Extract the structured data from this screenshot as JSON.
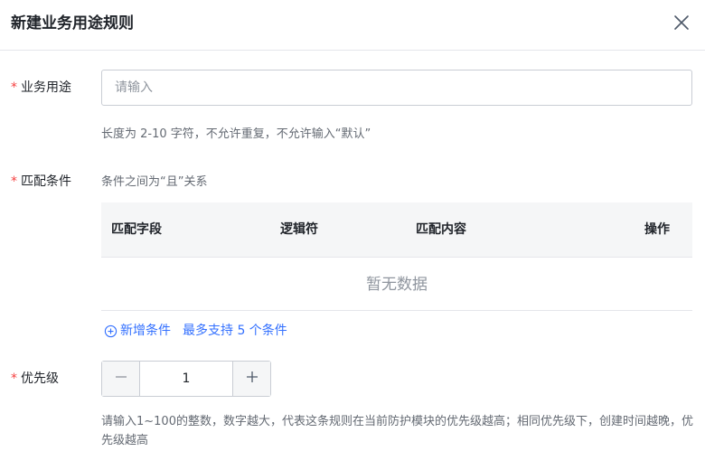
{
  "dialog": {
    "title": "新建业务用途规则",
    "close_icon": "close-icon"
  },
  "form": {
    "purpose": {
      "required_mark": "*",
      "label": "业务用途",
      "placeholder": "请输入",
      "value": "",
      "hint": "长度为 2-10 字符，不允许重复，不允许输入“默认”"
    },
    "conditions": {
      "required_mark": "*",
      "label": "匹配条件",
      "hint": "条件之间为“且”关系",
      "columns": [
        "匹配字段",
        "逻辑符",
        "匹配内容",
        "操作"
      ],
      "rows": [],
      "empty_text": "暂无数据",
      "add_label": "新增条件",
      "max_note": "最多支持 5 个条件",
      "add_icon": "plus-circle-icon"
    },
    "priority": {
      "required_mark": "*",
      "label": "优先级",
      "value": "1",
      "minus_icon": "minus-icon",
      "plus_icon": "plus-icon",
      "hint": "请输入1~100的整数，数字越大，代表这条规则在当前防护模块的优先级越高；相同优先级下，创建时间越晚，优先级越高"
    }
  },
  "colors": {
    "accent": "#3370ff",
    "required": "#f53f3f",
    "text": "#1f2329",
    "muted": "#646a73",
    "border": "#c9cdd4",
    "header_bg": "#f5f6f7"
  }
}
